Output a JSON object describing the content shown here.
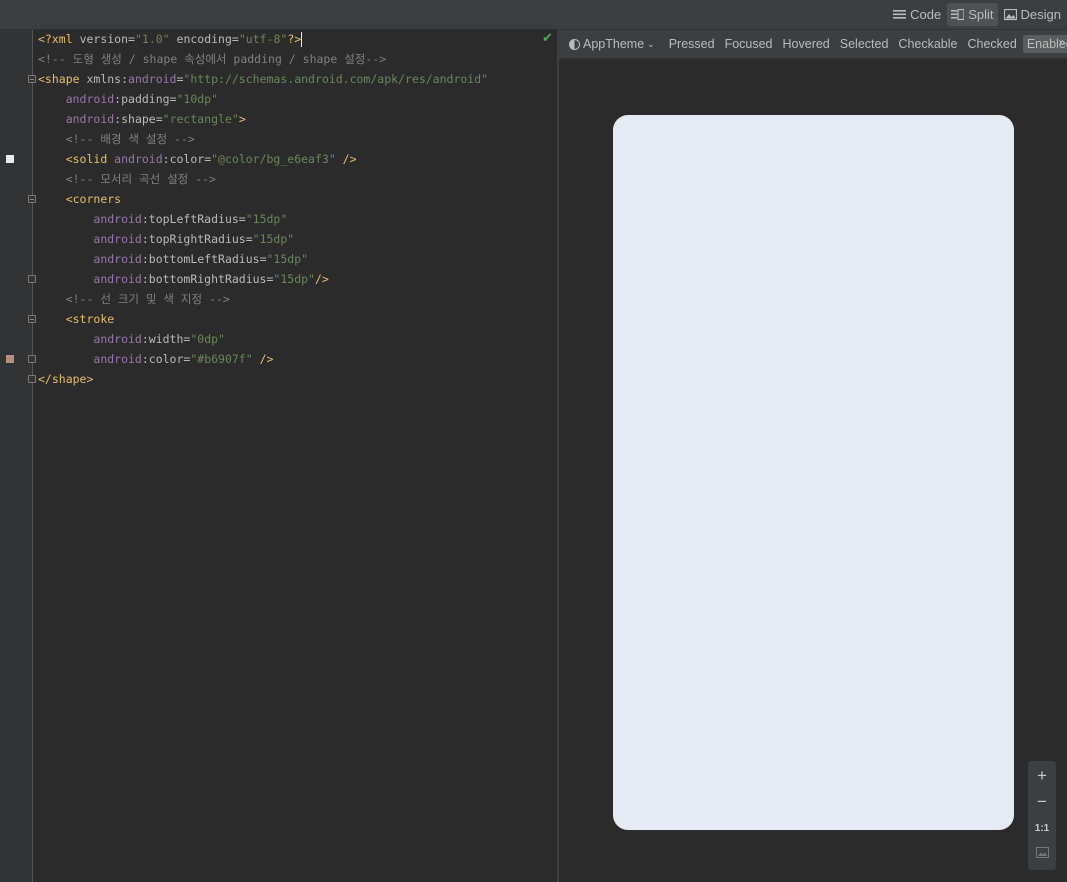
{
  "view_modes": {
    "code": "Code",
    "split": "Split",
    "design": "Design",
    "active": "split"
  },
  "editor": {
    "lines": [
      [
        [
          "pi",
          "<?"
        ],
        [
          "tag",
          "xml"
        ],
        [
          "attr",
          " version"
        ],
        [
          "attr",
          "="
        ],
        [
          "val",
          "\"1.0\""
        ],
        [
          "attr",
          " encoding"
        ],
        [
          "attr",
          "="
        ],
        [
          "val",
          "\"utf-8\""
        ],
        [
          "pi",
          "?>"
        ]
      ],
      [
        [
          "cmt",
          "<!-- 도형 생성 / shape 속성에서 padding / shape 설정-->"
        ]
      ],
      [
        [
          "tag",
          "<shape "
        ],
        [
          "attr",
          "xmlns:"
        ],
        [
          "ns",
          "android"
        ],
        [
          "attr",
          "="
        ],
        [
          "val",
          "\"http://schemas.android.com/apk/res/android\""
        ]
      ],
      [
        [
          "txt",
          "    "
        ],
        [
          "ns",
          "android"
        ],
        [
          "attr",
          ":padding"
        ],
        [
          "attr",
          "="
        ],
        [
          "val",
          "\"10dp\""
        ]
      ],
      [
        [
          "txt",
          "    "
        ],
        [
          "ns",
          "android"
        ],
        [
          "attr",
          ":shape"
        ],
        [
          "attr",
          "="
        ],
        [
          "val",
          "\"rectangle\""
        ],
        [
          "tag",
          ">"
        ]
      ],
      [
        [
          "txt",
          "    "
        ],
        [
          "cmt",
          "<!-- 배경 색 설정 -->"
        ]
      ],
      [
        [
          "txt",
          "    "
        ],
        [
          "tag",
          "<solid "
        ],
        [
          "ns",
          "android"
        ],
        [
          "attr",
          ":color"
        ],
        [
          "attr",
          "="
        ],
        [
          "val",
          "\"@color/bg_e6eaf3\""
        ],
        [
          "tag",
          " />"
        ]
      ],
      [
        [
          "txt",
          "    "
        ],
        [
          "cmt",
          "<!-- 모서리 곡선 설정 -->"
        ]
      ],
      [
        [
          "txt",
          "    "
        ],
        [
          "tag",
          "<corners"
        ]
      ],
      [
        [
          "txt",
          "        "
        ],
        [
          "ns",
          "android"
        ],
        [
          "attr",
          ":topLeftRadius"
        ],
        [
          "attr",
          "="
        ],
        [
          "val",
          "\"15dp\""
        ]
      ],
      [
        [
          "txt",
          "        "
        ],
        [
          "ns",
          "android"
        ],
        [
          "attr",
          ":topRightRadius"
        ],
        [
          "attr",
          "="
        ],
        [
          "val",
          "\"15dp\""
        ]
      ],
      [
        [
          "txt",
          "        "
        ],
        [
          "ns",
          "android"
        ],
        [
          "attr",
          ":bottomLeftRadius"
        ],
        [
          "attr",
          "="
        ],
        [
          "val",
          "\"15dp\""
        ]
      ],
      [
        [
          "txt",
          "        "
        ],
        [
          "ns",
          "android"
        ],
        [
          "attr",
          ":bottomRightRadius"
        ],
        [
          "attr",
          "="
        ],
        [
          "val",
          "\"15dp\""
        ],
        [
          "tag",
          "/>"
        ]
      ],
      [
        [
          "txt",
          "    "
        ],
        [
          "cmt",
          "<!-- 선 크기 및 색 지정 -->"
        ]
      ],
      [
        [
          "txt",
          "    "
        ],
        [
          "tag",
          "<stroke"
        ]
      ],
      [
        [
          "txt",
          "        "
        ],
        [
          "ns",
          "android"
        ],
        [
          "attr",
          ":width"
        ],
        [
          "attr",
          "="
        ],
        [
          "val",
          "\"0dp\""
        ]
      ],
      [
        [
          "txt",
          "        "
        ],
        [
          "ns",
          "android"
        ],
        [
          "attr",
          ":color"
        ],
        [
          "attr",
          "="
        ],
        [
          "val",
          "\"#b6907f\""
        ],
        [
          "tag",
          " />"
        ]
      ],
      [
        [
          "tag",
          "</shape>"
        ]
      ]
    ],
    "color_swatches": [
      {
        "line": 7,
        "color": "#e6eaf3"
      },
      {
        "line": 17,
        "color": "#b6907f"
      }
    ]
  },
  "preview": {
    "theme": "AppTheme",
    "states": [
      "Pressed",
      "Focused",
      "Hovered",
      "Selected",
      "Checkable",
      "Checked",
      "Enabled"
    ],
    "active_state": "Enabled",
    "shape_color": "#e6eaf3",
    "zoom_controls": {
      "zoom_in": "+",
      "zoom_out": "−",
      "actual_size": "1:1"
    }
  }
}
